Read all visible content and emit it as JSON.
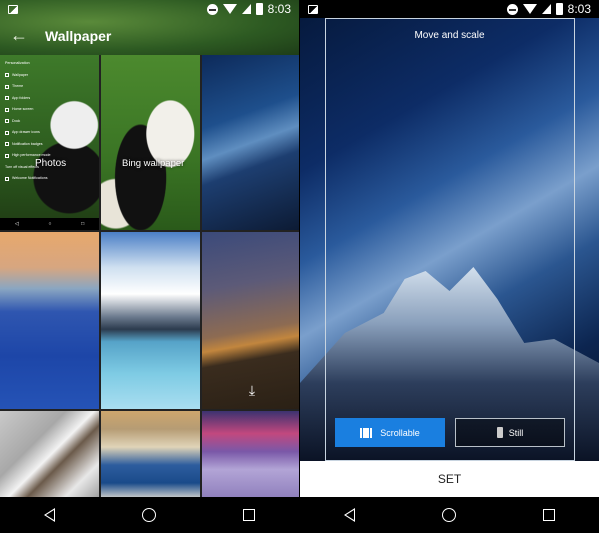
{
  "status_bar": {
    "time": "8:03",
    "icons": [
      "image-notification-icon",
      "do-not-disturb-icon",
      "wifi-icon",
      "cellular-signal-icon",
      "battery-icon"
    ]
  },
  "left_screen": {
    "app_bar": {
      "title": "Wallpaper",
      "back_icon": "arrow-left-icon"
    },
    "tiles": [
      {
        "label": "Photos",
        "kind": "photos",
        "preview_menu": [
          "Personalization",
          "Wallpaper",
          "Theme",
          "App folders",
          "Home screen",
          "Dock",
          "App drawer icons",
          "Notification badges",
          "High performance mode",
          "Turn off visual effects",
          "Welcome Notifications"
        ]
      },
      {
        "label": "Bing wallpaper",
        "kind": "bing"
      },
      {
        "label": "",
        "kind": "milky-way-mountain"
      },
      {
        "label": "",
        "kind": "castle-blue-hill"
      },
      {
        "label": "",
        "kind": "mountain-lake"
      },
      {
        "label": "",
        "kind": "tree-star-trails",
        "action_icon": "download-icon"
      },
      {
        "label": "",
        "kind": "snowy-ridge"
      },
      {
        "label": "",
        "kind": "blue-pyramid-peak"
      },
      {
        "label": "",
        "kind": "purple-snowfield"
      }
    ]
  },
  "right_screen": {
    "frame_title": "Move and scale",
    "mode_buttons": [
      {
        "label": "Scrollable",
        "selected": true
      },
      {
        "label": "Still",
        "selected": false
      }
    ],
    "set_button": "SET",
    "accent_color": "#1a7fe0"
  },
  "nav_bar": {
    "back": "Back",
    "home": "Home",
    "recents": "Recents"
  }
}
